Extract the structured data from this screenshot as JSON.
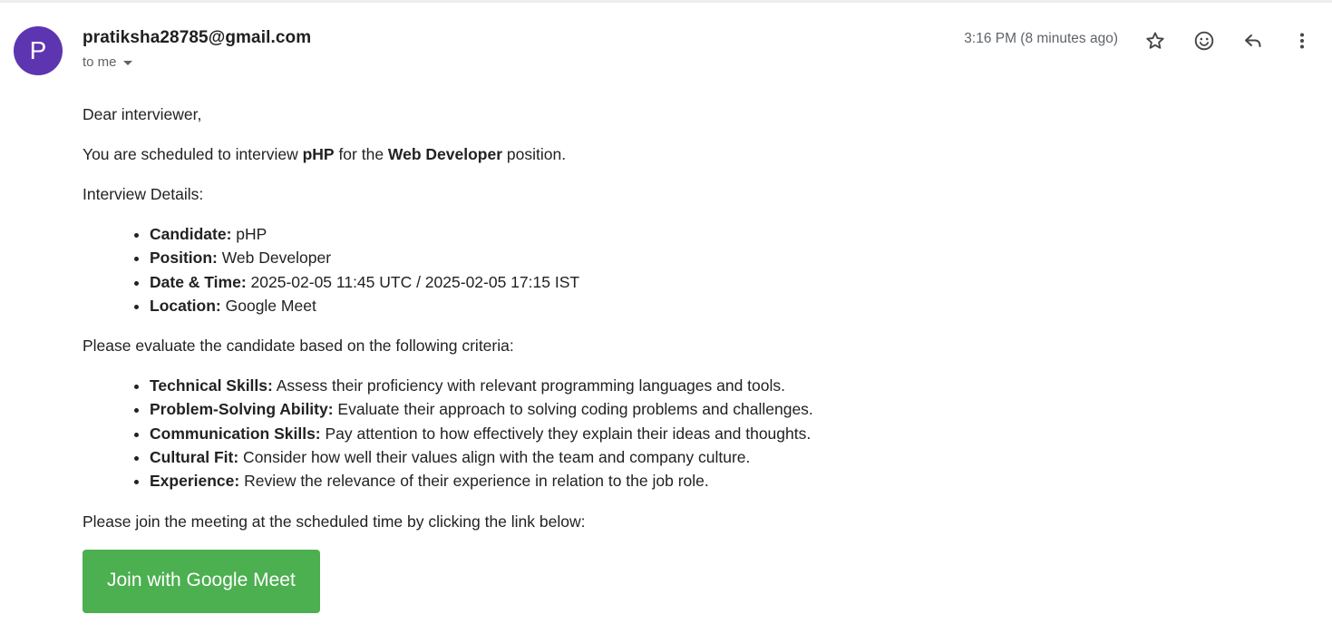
{
  "header": {
    "avatar_letter": "P",
    "sender": "pratiksha28785@gmail.com",
    "recipient": "to me",
    "timestamp": "3:16 PM (8 minutes ago)",
    "icons": [
      "star-icon",
      "emoji-icon",
      "reply-icon",
      "more-vert-icon"
    ]
  },
  "message": {
    "greeting": "Dear interviewer,",
    "intro": {
      "prefix": "You are scheduled to interview ",
      "candidate": "pHP",
      "middle": " for the ",
      "position": "Web Developer",
      "suffix": " position."
    },
    "details_heading": "Interview Details:",
    "details": [
      {
        "label": "Candidate:",
        "value": " pHP"
      },
      {
        "label": "Position:",
        "value": " Web Developer"
      },
      {
        "label": "Date & Time:",
        "value": " 2025-02-05 11:45 UTC / 2025-02-05 17:15 IST"
      },
      {
        "label": "Location:",
        "value": " Google Meet"
      }
    ],
    "criteria_heading": "Please evaluate the candidate based on the following criteria:",
    "criteria": [
      {
        "label": "Technical Skills:",
        "value": " Assess their proficiency with relevant programming languages and tools."
      },
      {
        "label": "Problem-Solving Ability:",
        "value": " Evaluate their approach to solving coding problems and challenges."
      },
      {
        "label": "Communication Skills:",
        "value": " Pay attention to how effectively they explain their ideas and thoughts."
      },
      {
        "label": "Cultural Fit:",
        "value": " Consider how well their values align with the team and company culture."
      },
      {
        "label": "Experience:",
        "value": " Review the relevance of their experience in relation to the job role."
      }
    ],
    "join_text": "Please join the meeting at the scheduled time by clicking the link below:",
    "join_button": "Join with Google Meet"
  },
  "colors": {
    "avatar": "#5e35b1",
    "button": "#4caf50",
    "muted": "#5f6368"
  }
}
